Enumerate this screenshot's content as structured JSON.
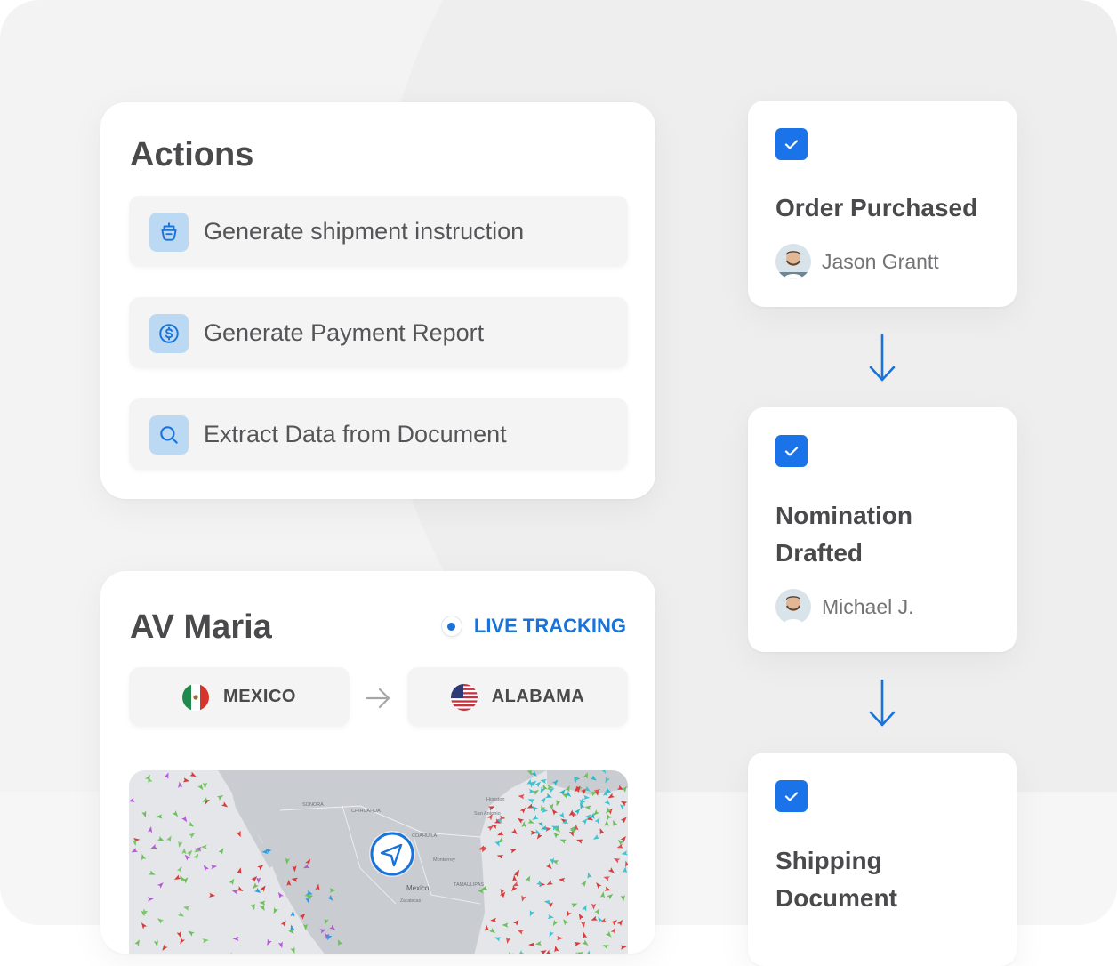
{
  "actions": {
    "heading": "Actions",
    "items": [
      {
        "label": "Generate shipment instruction",
        "icon": "ship-icon"
      },
      {
        "label": "Generate Payment Report",
        "icon": "dollar-circle-icon"
      },
      {
        "label": "Extract Data from Document",
        "icon": "search-icon"
      }
    ]
  },
  "vessel": {
    "name": "AV Maria",
    "live_label": "LIVE TRACKING",
    "origin": "MEXICO",
    "destination": "ALABAMA",
    "map_labels": [
      "Mexico",
      "SONORA",
      "CHIHUAHUA",
      "COAHUILA",
      "Monterrey",
      "TAMAULIPAS",
      "Houston",
      "San Antonio",
      "Zacatecas"
    ]
  },
  "workflow": {
    "steps": [
      {
        "title": "Order Purchased",
        "user": "Jason Grantt",
        "checked": true
      },
      {
        "title": "Nomination Drafted",
        "user": "Michael J.",
        "checked": true
      },
      {
        "title": "Shipping Document",
        "checked": true
      }
    ]
  },
  "colors": {
    "accent": "#1a73e8",
    "icon_bg": "#bcd9f3",
    "text_dark": "#4a4a4c",
    "text_muted": "#737376"
  }
}
